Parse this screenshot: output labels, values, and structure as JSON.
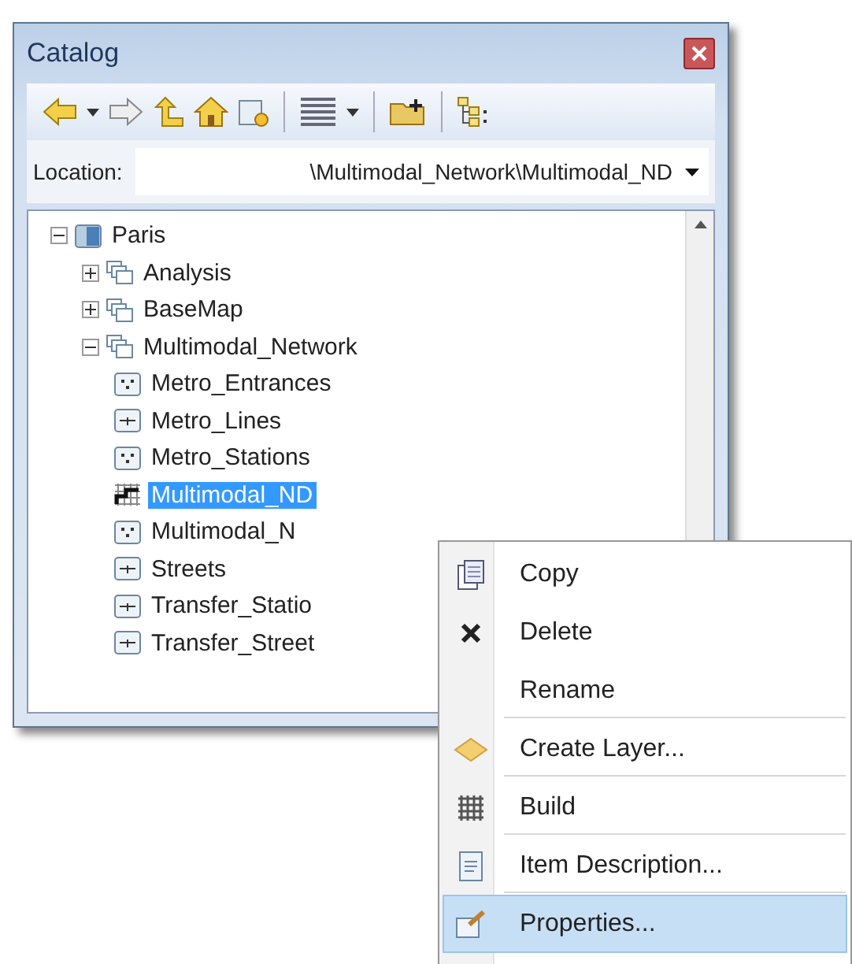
{
  "window": {
    "title": "Catalog"
  },
  "toolbar": {
    "buttons": [
      {
        "kind": "back"
      },
      {
        "kind": "dropdown"
      },
      {
        "kind": "forward"
      },
      {
        "kind": "up"
      },
      {
        "kind": "home"
      },
      {
        "kind": "connect"
      },
      {
        "kind": "sep"
      },
      {
        "kind": "views"
      },
      {
        "kind": "dropdown"
      },
      {
        "kind": "sep"
      },
      {
        "kind": "newfolder"
      },
      {
        "kind": "sep"
      },
      {
        "kind": "tree"
      }
    ]
  },
  "location": {
    "label": "Location:",
    "value": "\\Multimodal_Network\\Multimodal_ND"
  },
  "tree": [
    {
      "label": "Paris",
      "kind": "database",
      "expanded": true,
      "selected": false,
      "children": [
        {
          "label": "Analysis",
          "kind": "dataset",
          "expanded": false,
          "selected": false
        },
        {
          "label": "BaseMap",
          "kind": "dataset",
          "expanded": false,
          "selected": false
        },
        {
          "label": "Multimodal_Network",
          "kind": "dataset",
          "expanded": true,
          "selected": false,
          "children": [
            {
              "label": "Metro_Entrances",
              "kind": "point",
              "selected": false
            },
            {
              "label": "Metro_Lines",
              "kind": "line",
              "selected": false
            },
            {
              "label": "Metro_Stations",
              "kind": "point",
              "selected": false
            },
            {
              "label": "Multimodal_ND",
              "kind": "network",
              "selected": true
            },
            {
              "label": "Multimodal_N",
              "kind": "point",
              "selected": false
            },
            {
              "label": "Streets",
              "kind": "line",
              "selected": false
            },
            {
              "label": "Transfer_Statio",
              "kind": "line",
              "selected": false
            },
            {
              "label": "Transfer_Street",
              "kind": "line",
              "selected": false
            }
          ]
        }
      ]
    }
  ],
  "context_menu": {
    "items": [
      {
        "label": "Copy",
        "kind": "copy",
        "selected": false,
        "separator_after": false
      },
      {
        "label": "Delete",
        "kind": "delete",
        "selected": false,
        "separator_after": false
      },
      {
        "label": "Rename",
        "kind": "plain",
        "selected": false,
        "separator_after": true
      },
      {
        "label": "Create Layer...",
        "kind": "layer",
        "selected": false,
        "separator_after": true
      },
      {
        "label": "Build",
        "kind": "build",
        "selected": false,
        "separator_after": true
      },
      {
        "label": "Item Description...",
        "kind": "description",
        "selected": false,
        "separator_after": true
      },
      {
        "label": "Properties...",
        "kind": "properties",
        "selected": true,
        "separator_after": false
      }
    ]
  }
}
